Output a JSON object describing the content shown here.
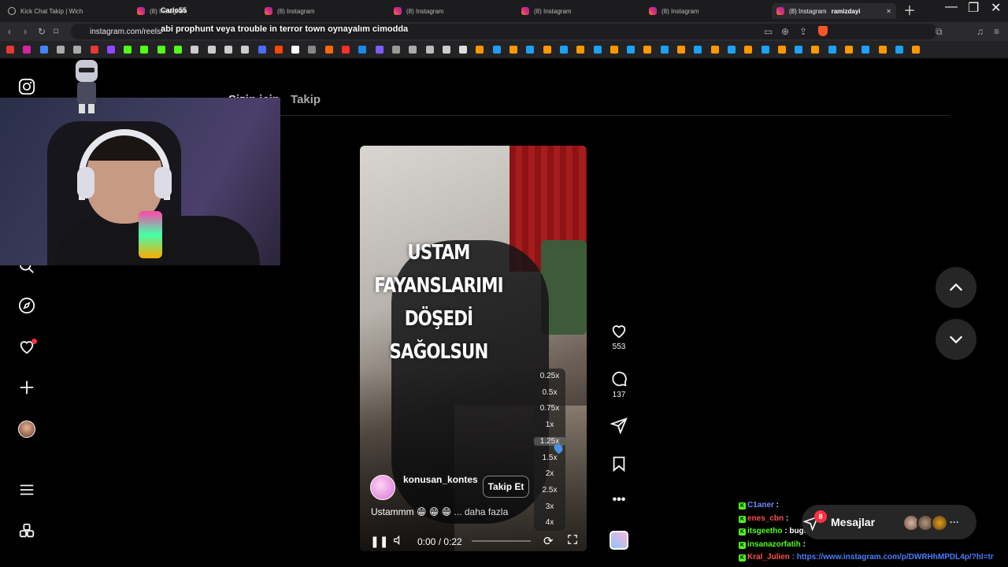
{
  "browser": {
    "tabs": [
      {
        "label": "Kick Chat Takip | Wich"
      },
      {
        "label": "(8) Instagram"
      },
      {
        "label": "(8) Instagram"
      },
      {
        "label": "(8) Instagram"
      },
      {
        "label": "(8) Instagram"
      },
      {
        "label": "(8) Instagram"
      },
      {
        "label": "(8) Instagram"
      }
    ],
    "profile_name_1": "Carlo55",
    "profile_name_2": "ramizdayi",
    "url": "instagram.com/reels/",
    "overlay_text": "abi prophunt veya trouble in terror town oynayalım cimodda"
  },
  "feed_tabs": {
    "tab_1": "Sizin için",
    "tab_2": "Takip"
  },
  "reel": {
    "caption_lines": [
      "USTAM",
      "FAYANSLARIMI",
      "DÖŞEDİ",
      "SAĞOLSUN"
    ],
    "username": "konusan_kontes",
    "follow_label": "Takip Et",
    "description": "Ustammm 😁 😁 😁",
    "more_label": "... daha fazla",
    "time": "0:00 / 0:22",
    "speed_options": [
      "0.25x",
      "0.5x",
      "0.75x",
      "1x",
      "1.25x",
      "1.5x",
      "2x",
      "2.5x",
      "3x",
      "4x"
    ],
    "selected_speed": "1.25x"
  },
  "actions": {
    "likes": "553",
    "comments": "137"
  },
  "chat": [
    {
      "user": "C1aner",
      "message": ":",
      "color": "#6c8cff"
    },
    {
      "user": "enes_cbn",
      "message": ":",
      "color": "#ff4d4d"
    },
    {
      "user": "itsgeetho",
      "message": ": bugün dönüyomuş 🫠",
      "color": "#53fc18"
    },
    {
      "user": "insanazorfatih",
      "message": ":",
      "color": "#53fc18"
    },
    {
      "user": "Kral_Julien",
      "message": ": https://www.instagram.com/p/DWRHhMPDL4p/?hl=tr",
      "color": "#ff4d4d"
    }
  ],
  "messages": {
    "label": "Mesajlar",
    "badge": "8"
  },
  "colors": {
    "accent_red": "#ff3040",
    "link_blue": "#4a7dff"
  }
}
